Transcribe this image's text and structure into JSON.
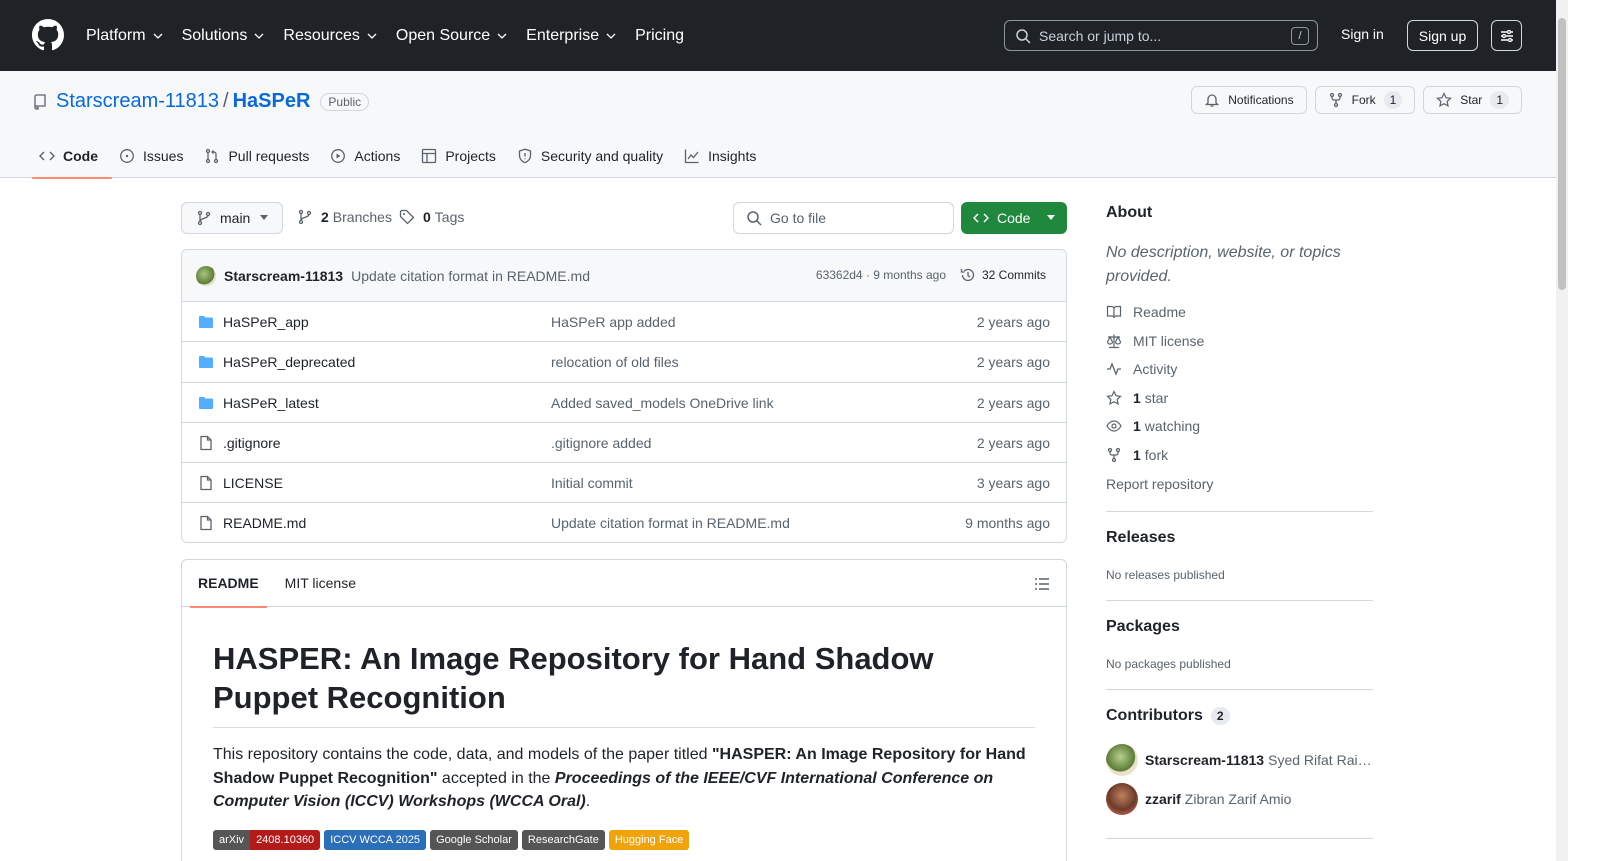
{
  "header": {
    "nav": [
      "Platform",
      "Solutions",
      "Resources",
      "Open Source",
      "Enterprise",
      "Pricing"
    ],
    "search_placeholder": "Search or jump to...",
    "slash_key": "/",
    "sign_in": "Sign in",
    "sign_up": "Sign up"
  },
  "repo": {
    "owner": "Starscream-11813",
    "separator": "/",
    "name": "HaSPeR",
    "visibility": "Public",
    "notifications_label": "Notifications",
    "fork_label": "Fork",
    "fork_count": "1",
    "star_label": "Star",
    "star_count": "1"
  },
  "tabs": [
    "Code",
    "Issues",
    "Pull requests",
    "Actions",
    "Projects",
    "Security and quality",
    "Insights"
  ],
  "branch": {
    "current": "main",
    "branches_count": "2",
    "branches_label": "Branches",
    "tags_count": "0",
    "tags_label": "Tags",
    "goto_placeholder": "Go to file",
    "code_button": "Code"
  },
  "commit": {
    "author": "Starscream-11813",
    "message": "Update citation format in README.md",
    "meta": "63362d4 · 9 months ago",
    "commits": "32 Commits"
  },
  "files": [
    {
      "type": "folder",
      "name": "HaSPeR_app",
      "message": "HaSPeR app added",
      "age": "2 years ago"
    },
    {
      "type": "folder",
      "name": "HaSPeR_deprecated",
      "message": "relocation of old files",
      "age": "2 years ago"
    },
    {
      "type": "folder",
      "name": "HaSPeR_latest",
      "message": "Added saved_models OneDrive link",
      "age": "2 years ago"
    },
    {
      "type": "file",
      "name": ".gitignore",
      "message": ".gitignore added",
      "age": "2 years ago"
    },
    {
      "type": "file",
      "name": "LICENSE",
      "message": "Initial commit",
      "age": "3 years ago"
    },
    {
      "type": "file",
      "name": "README.md",
      "message": "Update citation format in README.md",
      "age": "9 months ago"
    }
  ],
  "readme": {
    "tab_readme": "README",
    "tab_license": "MIT license",
    "title": "HASPER: An Image Repository for Hand Shadow Puppet Recognition",
    "p_part1": "This repository contains the code, data, and models of the paper titled ",
    "p_bold": "\"HASPER: An Image Repository for Hand Shadow Puppet Recognition\"",
    "p_part2": " accepted in the ",
    "p_italic": "Proceedings of the IEEE/CVF International Conference on Computer Vision (ICCV) Workshops (WCCA Oral)",
    "p_end": ".",
    "badges": [
      {
        "left": "arXiv",
        "right": "2408.10360",
        "color": "#b31b1b"
      },
      {
        "left": "",
        "right": "ICCV WCCA 2025",
        "color": "#2a6fb8"
      },
      {
        "left": "",
        "right": "Google Scholar",
        "color": "#555555"
      },
      {
        "left": "",
        "right": "ResearchGate",
        "color": "#555555"
      },
      {
        "left": "",
        "right": "Hugging Face",
        "color": "#f0a30a"
      }
    ]
  },
  "sidebar": {
    "about_title": "About",
    "about_desc": "No description, website, or topics provided.",
    "links": [
      {
        "icon": "book-icon",
        "bold": "",
        "text": "Readme"
      },
      {
        "icon": "law-icon",
        "bold": "",
        "text": "MIT license"
      },
      {
        "icon": "pulse-icon",
        "bold": "",
        "text": "Activity"
      },
      {
        "icon": "star-icon",
        "bold": "1",
        "text": "star"
      },
      {
        "icon": "eye-icon",
        "bold": "1",
        "text": "watching"
      },
      {
        "icon": "fork-icon",
        "bold": "1",
        "text": "fork"
      }
    ],
    "report": "Report repository",
    "releases_title": "Releases",
    "releases_text": "No releases published",
    "packages_title": "Packages",
    "packages_text": "No packages published",
    "contributors_title": "Contributors",
    "contributors_count": "2",
    "contributors": [
      {
        "login": "Starscream-11813",
        "name": "Syed Rifat Raiyan"
      },
      {
        "login": "zzarif",
        "name": "Zibran Zarif Amio"
      }
    ]
  }
}
